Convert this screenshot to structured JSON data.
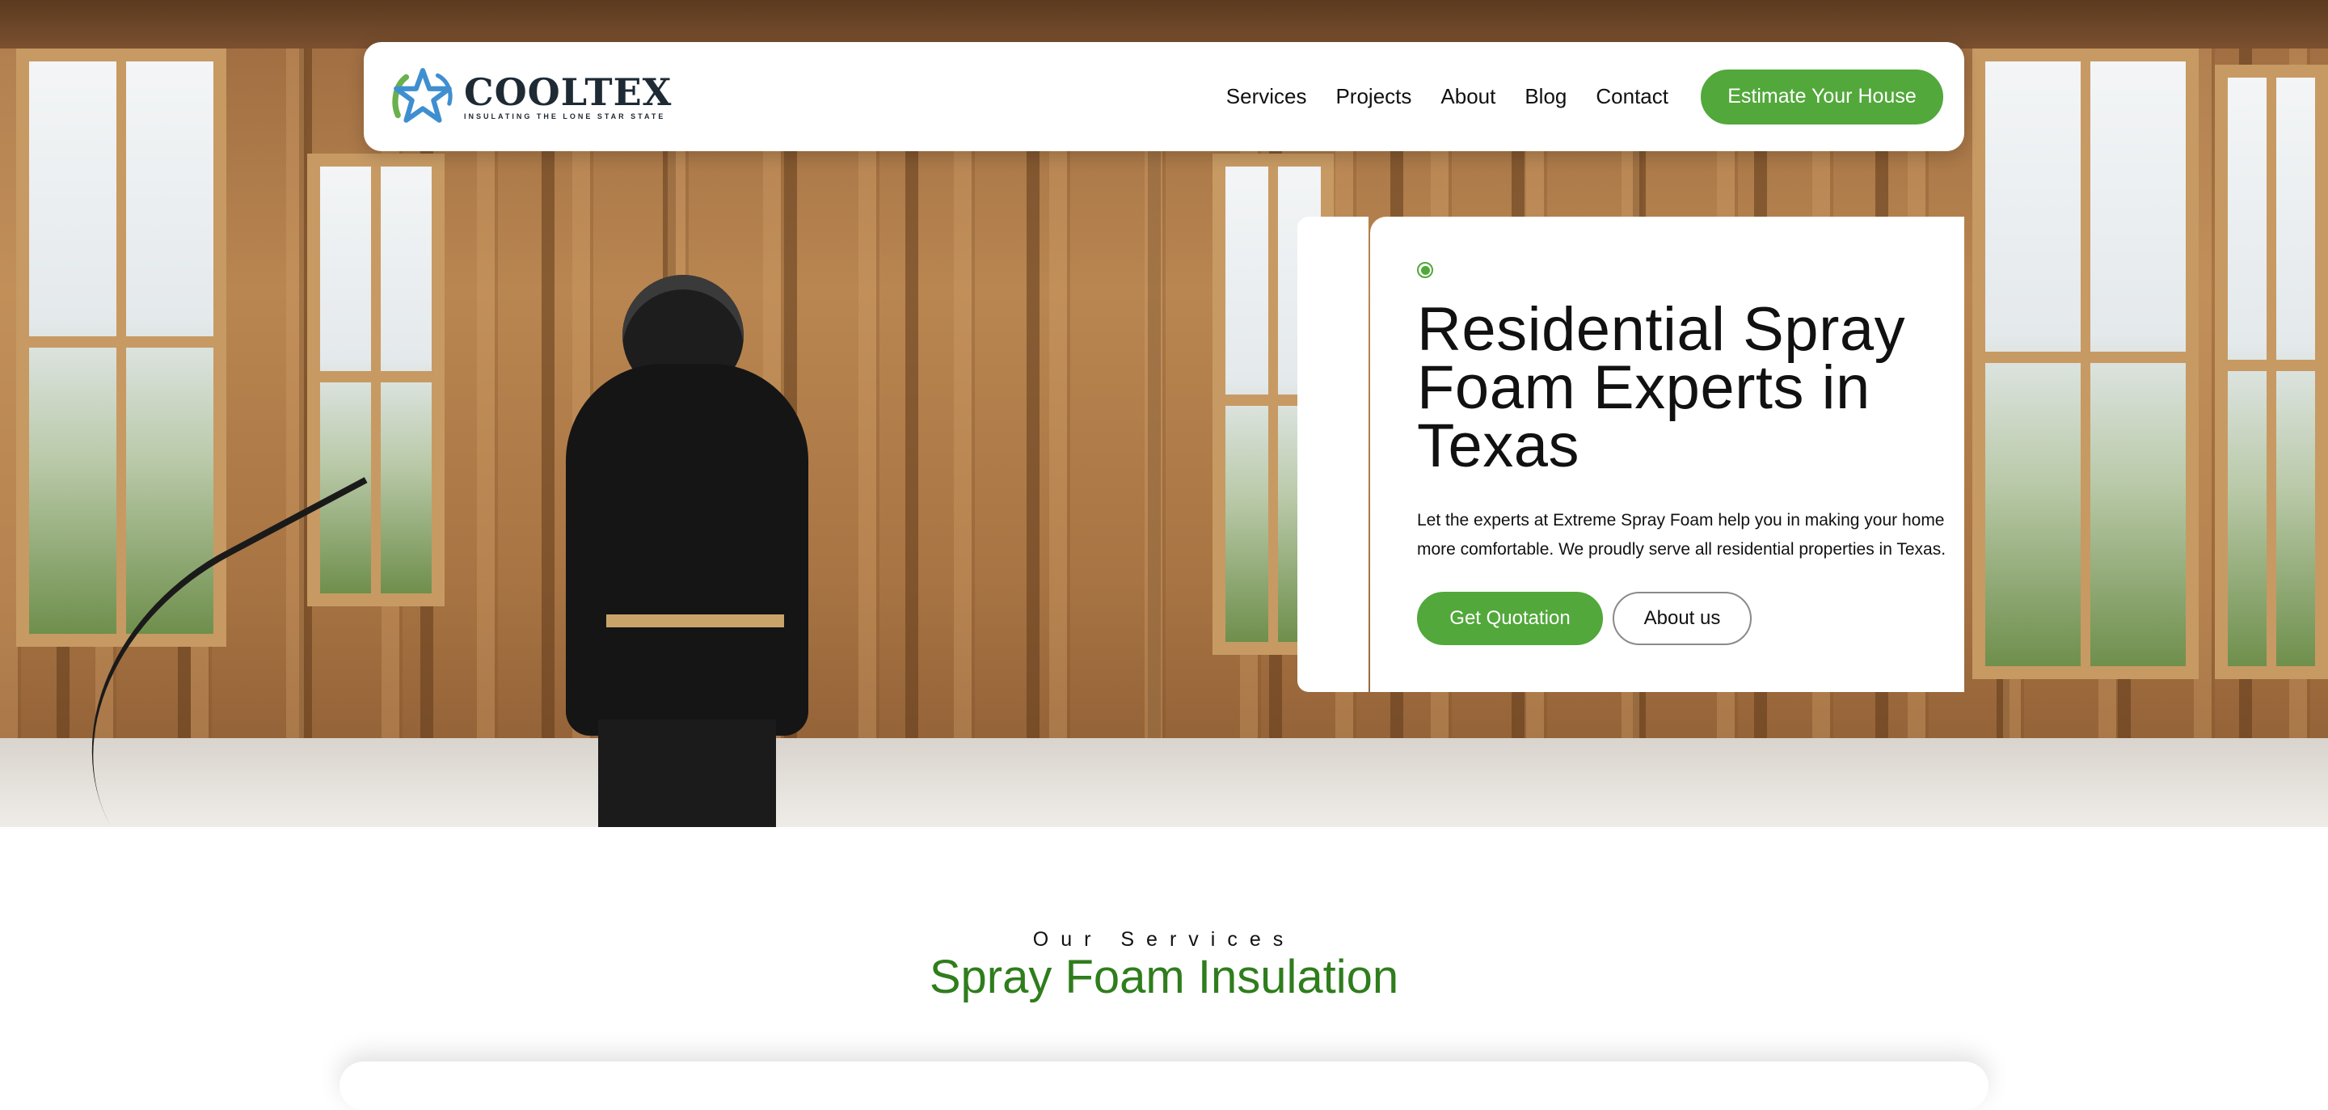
{
  "brand": {
    "name": "COOLTEX",
    "tagline": "INSULATING THE LONE STAR STATE",
    "logo_icon": "star-logo-icon"
  },
  "nav": {
    "items": [
      {
        "label": "Services"
      },
      {
        "label": "Projects"
      },
      {
        "label": "About"
      },
      {
        "label": "Blog"
      },
      {
        "label": "Contact"
      }
    ],
    "cta_label": "Estimate Your House"
  },
  "hero": {
    "title": "Residential Spray Foam Experts in Texas",
    "description": "Let the experts at Extreme Spray Foam help you in making your home more comfortable. We proudly serve all residential properties in Texas.",
    "primary_button": "Get Quotation",
    "secondary_button": "About us"
  },
  "services": {
    "eyebrow": "Our Services",
    "title": "Spray Foam Insulation"
  },
  "colors": {
    "accent": "#52a83b",
    "heading_green": "#2f7d1d",
    "text": "#111111"
  }
}
